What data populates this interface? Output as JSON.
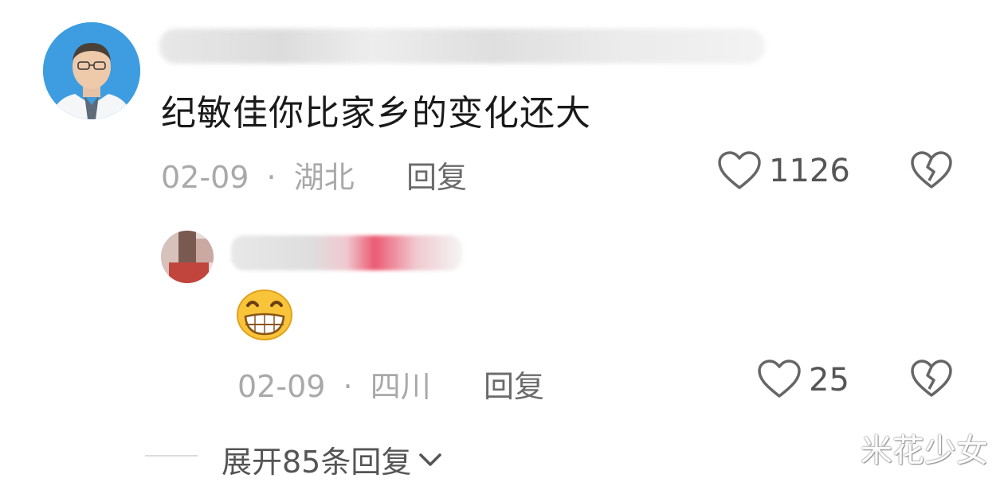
{
  "comment": {
    "text": "纪敏佳你比家乡的变化还大",
    "date": "02-09",
    "location": "湖北",
    "separator": "·",
    "reply_label": "回复",
    "like_count": "1126"
  },
  "reply": {
    "emoji": "😁",
    "date": "02-09",
    "location": "四川",
    "separator": "·",
    "reply_label": "回复",
    "like_count": "25"
  },
  "expand": {
    "label": "展开85条回复"
  },
  "watermark": "米花少女",
  "colors": {
    "meta": "#a9a9a9",
    "text": "#1a1a1a",
    "highlight_pink": "#ec5a72"
  }
}
